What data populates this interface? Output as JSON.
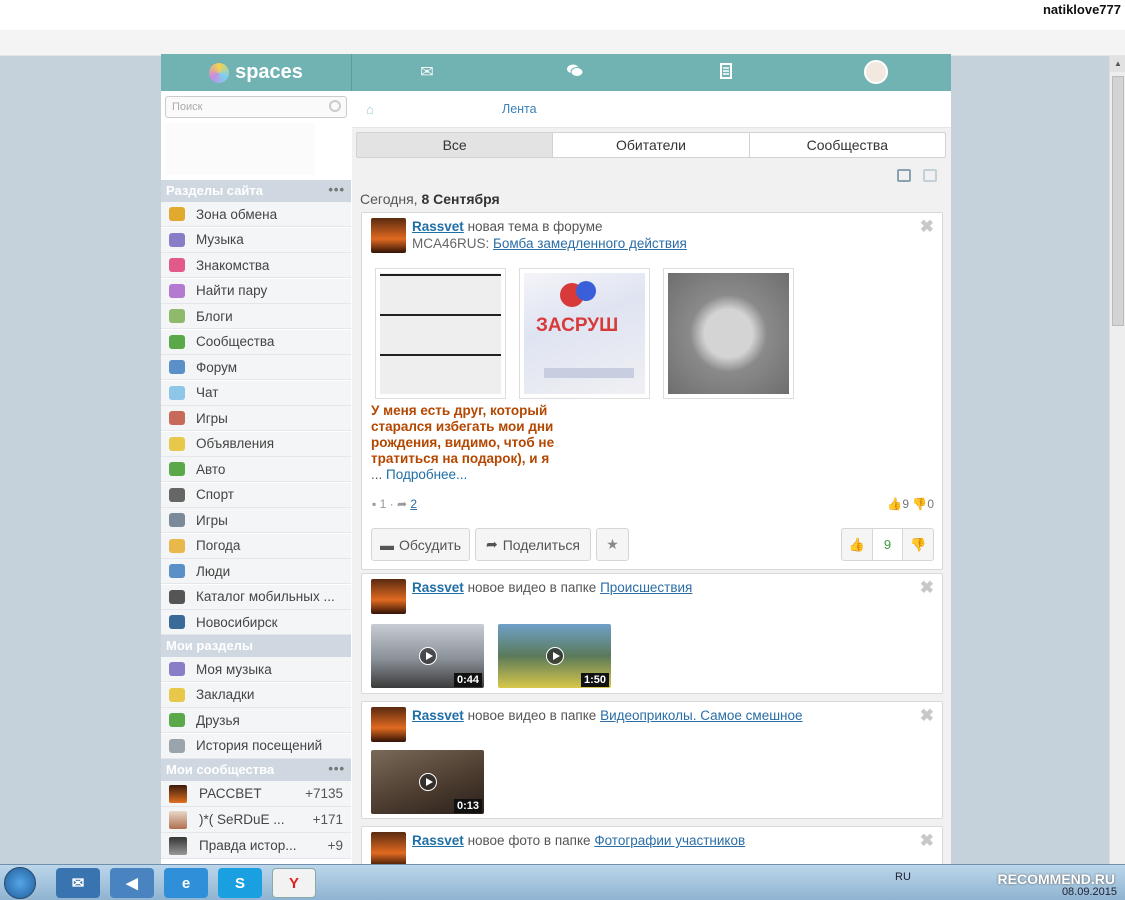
{
  "browser": {
    "username": "natiklove777"
  },
  "site": {
    "logo_text": "spaces",
    "header_icons": [
      "mail-icon",
      "chat-icon",
      "journal-icon"
    ],
    "search_placeholder": "Поиск"
  },
  "sidebar": {
    "section_site": "Разделы сайта",
    "site_items": [
      {
        "label": "Зона обмена",
        "icon": "grid-icon",
        "color": "#e1a92d"
      },
      {
        "label": "Музыка",
        "icon": "music-icon",
        "color": "#8a7dc8"
      },
      {
        "label": "Знакомства",
        "icon": "heart-icon",
        "color": "#e25a8a"
      },
      {
        "label": "Найти пару",
        "icon": "broken-heart-icon",
        "color": "#b47ad1"
      },
      {
        "label": "Блоги",
        "icon": "pen-icon",
        "color": "#8fba6b"
      },
      {
        "label": "Сообщества",
        "icon": "community-icon",
        "color": "#5aa84a"
      },
      {
        "label": "Форум",
        "icon": "forum-icon",
        "color": "#5a8fc8"
      },
      {
        "label": "Чат",
        "icon": "chat-bubble-icon",
        "color": "#8ec6e8"
      },
      {
        "label": "Игры",
        "icon": "swords-icon",
        "color": "#c86a5a"
      },
      {
        "label": "Объявления",
        "icon": "board-icon",
        "color": "#e8c84a"
      },
      {
        "label": "Авто",
        "icon": "car-icon",
        "color": "#5aa84a"
      },
      {
        "label": "Спорт",
        "icon": "ball-icon",
        "color": "#666666"
      },
      {
        "label": "Игры",
        "icon": "gamepad-icon",
        "color": "#7a8a98"
      },
      {
        "label": "Погода",
        "icon": "weather-icon",
        "color": "#e8b84a"
      },
      {
        "label": "Люди",
        "icon": "person-icon",
        "color": "#5a8fc8"
      },
      {
        "label": "Каталог мобильных ...",
        "icon": "phone-icon",
        "color": "#555555"
      },
      {
        "label": "Новосибирск",
        "icon": "city-icon",
        "color": "#3a6a98"
      }
    ],
    "section_mine": "Мои разделы",
    "my_items": [
      {
        "label": "Моя музыка",
        "icon": "music-icon",
        "color": "#8a7dc8"
      },
      {
        "label": "Закладки",
        "icon": "star-icon",
        "color": "#e8c84a"
      },
      {
        "label": "Друзья",
        "icon": "friends-icon",
        "color": "#5aa84a"
      },
      {
        "label": "История посещений",
        "icon": "footprints-icon",
        "color": "#9aa4ac"
      }
    ],
    "section_comm": "Мои сообщества",
    "communities": [
      {
        "label": "РАССВЕТ",
        "count": "+7135"
      },
      {
        "label": ")*( SeRDuE ...",
        "count": "+171"
      },
      {
        "label": "Правда истор...",
        "count": "+9"
      }
    ]
  },
  "main": {
    "breadcrumb": "Лента",
    "tabs": [
      "Все",
      "Обитатели",
      "Сообщества"
    ],
    "date_prefix": "Сегодня,",
    "date": "8 Сентября",
    "posts": [
      {
        "author": "Rassvet",
        "action": "новая тема в форуме",
        "sub_prefix": "MCA46RUS:",
        "sub_link": "Бомба замедленного действия",
        "excerpt": "У меня есть друг, который старался избегать мои дни рождения, видимо, чтоб не тратиться на подарок), и я",
        "ellipsis": "...",
        "more": "Подробнее...",
        "comments": "1",
        "shares": "2",
        "likes": "9",
        "dislikes": "0",
        "btn_discuss": "Обсудить",
        "btn_share": "Поделиться",
        "vote_count": "9"
      },
      {
        "author": "Rassvet",
        "action": "новое видео в папке",
        "link": "Происшествия",
        "videos": [
          "0:44",
          "1:50"
        ]
      },
      {
        "author": "Rassvet",
        "action": "новое видео в папке",
        "link": "Видеоприколы. Самое смешное",
        "videos": [
          "0:13"
        ]
      },
      {
        "author": "Rassvet",
        "action": "новое фото в папке",
        "link": "Фотографии участников"
      }
    ]
  },
  "taskbar": {
    "lang": "RU",
    "watermark": "RECOMMEND.RU",
    "date": "08.09.2015"
  }
}
